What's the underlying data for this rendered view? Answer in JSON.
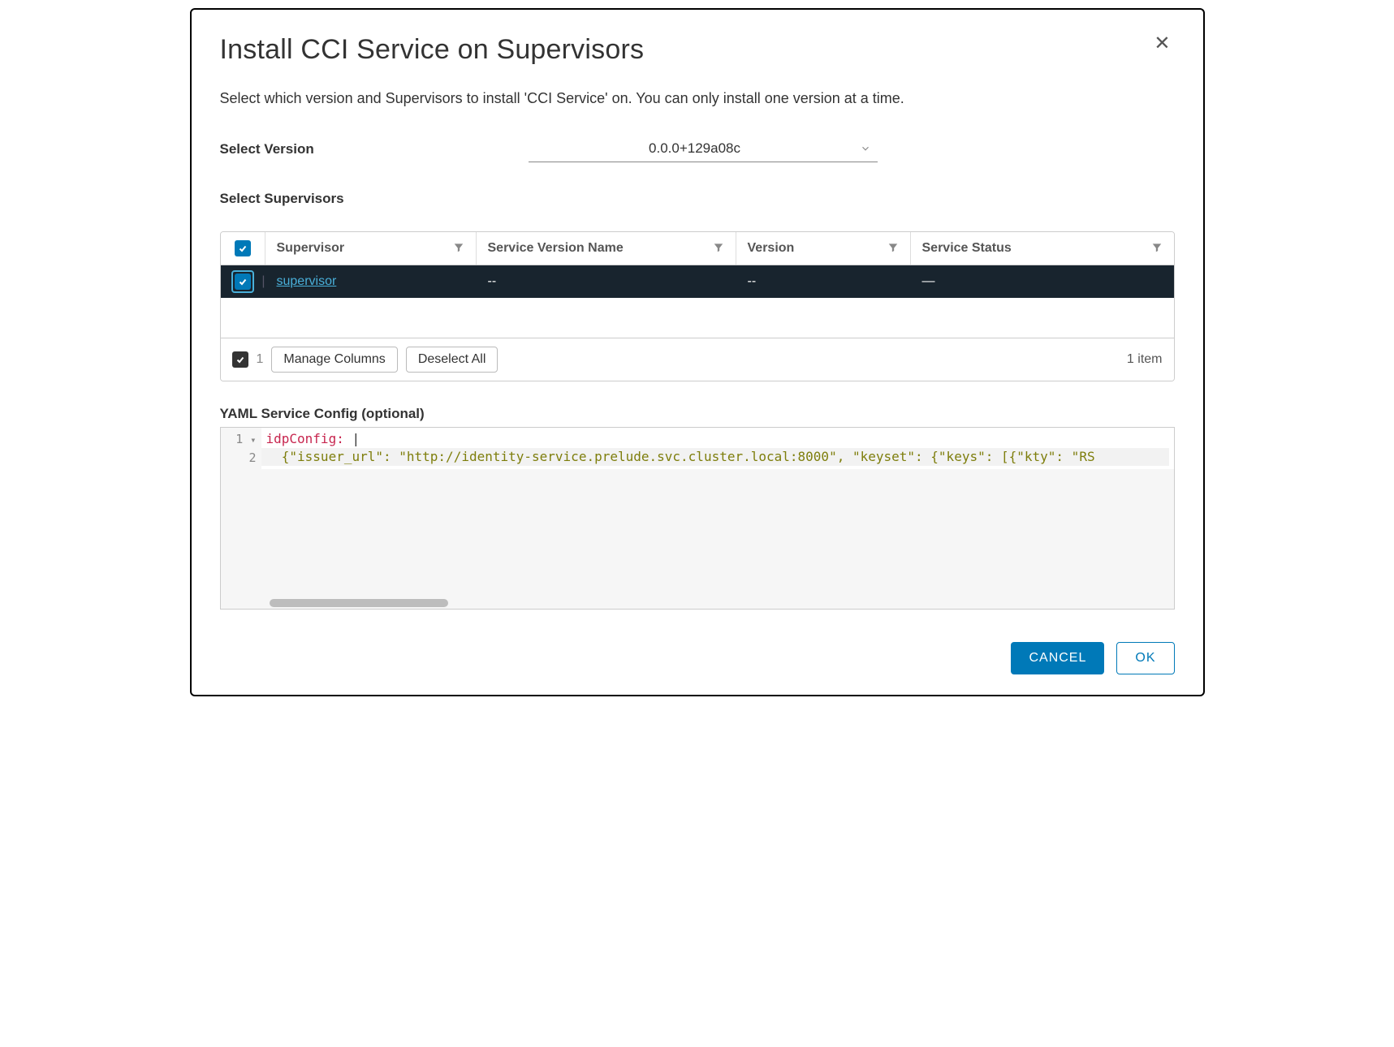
{
  "header": {
    "title": "Install CCI Service on Supervisors"
  },
  "description": "Select which version and Supervisors to install 'CCI Service' on. You can only install one version at a time.",
  "version": {
    "label": "Select Version",
    "selected": "0.0.0+129a08c"
  },
  "supervisors": {
    "label": "Select Supervisors",
    "columns": {
      "supervisor": "Supervisor",
      "service_version_name": "Service Version Name",
      "version": "Version",
      "service_status": "Service Status"
    },
    "rows": [
      {
        "name": "supervisor",
        "service_version_name": "--",
        "version": "--",
        "service_status": "—",
        "checked": true
      }
    ],
    "footer": {
      "selected_count": "1",
      "manage_columns": "Manage Columns",
      "deselect_all": "Deselect All",
      "item_count": "1 item"
    }
  },
  "yaml": {
    "label": "YAML Service Config (optional)",
    "line1_key": "idpConfig:",
    "line1_pipe": " |",
    "line2": "  {\"issuer_url\": \"http://identity-service.prelude.svc.cluster.local:8000\", \"keyset\": {\"keys\": [{\"kty\": \"RS",
    "gutter": {
      "l1": "1",
      "l2": "2"
    }
  },
  "footer": {
    "cancel": "CANCEL",
    "ok": "OK"
  }
}
